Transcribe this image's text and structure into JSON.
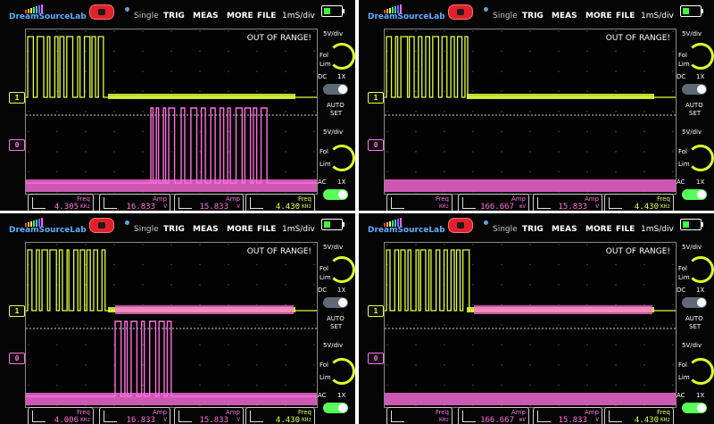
{
  "header": {
    "brand": "DreamSourceLab",
    "mode": "Single",
    "menu": [
      "TRIG",
      "MEAS",
      "MORE",
      "FILE"
    ],
    "timebase": "1mS/div"
  },
  "status": {
    "out_of_range": "OUT OF RANGE!"
  },
  "channels": {
    "ch1_marker": "1",
    "ch0_marker": "0"
  },
  "side_panel": {
    "ch1_scale": "5V/div",
    "ch0_scale": "5V/div",
    "fine": "Fol",
    "lim": "Lim",
    "dc": "DC",
    "ac": "AC",
    "x1": "1X",
    "auto": "AUTO",
    "set": "SET"
  },
  "colors": {
    "ch1": "#e2ff3a",
    "ch0": "#ff6ee0",
    "background": "#050505",
    "run_button": "#e0202a"
  },
  "screens": [
    {
      "id": "top-left",
      "measurements": [
        {
          "label": "Freq",
          "value": "4.305",
          "unit": "KHz"
        },
        {
          "label": "Amp",
          "value": "16.833",
          "unit": "V"
        },
        {
          "label": "Amp",
          "value": "15.833",
          "unit": "V"
        },
        {
          "label": "Freq",
          "value": "4.430",
          "unit": "KHz"
        }
      ]
    },
    {
      "id": "top-right",
      "measurements": [
        {
          "label": "Freq",
          "value": "",
          "unit": "KHz"
        },
        {
          "label": "Amp",
          "value": "166.667",
          "unit": "mV"
        },
        {
          "label": "Amp",
          "value": "15.833",
          "unit": "V"
        },
        {
          "label": "Freq",
          "value": "4.430",
          "unit": "KHz"
        }
      ]
    },
    {
      "id": "bottom-left",
      "measurements": [
        {
          "label": "Freq",
          "value": "4.006",
          "unit": "KHz"
        },
        {
          "label": "Amp",
          "value": "16.833",
          "unit": "V"
        },
        {
          "label": "Amp",
          "value": "15.833",
          "unit": "V"
        },
        {
          "label": "Freq",
          "value": "4.430",
          "unit": "KHz"
        }
      ]
    },
    {
      "id": "bottom-right",
      "measurements": [
        {
          "label": "Freq",
          "value": "",
          "unit": "KHz"
        },
        {
          "label": "Amp",
          "value": "166.667",
          "unit": "mV"
        },
        {
          "label": "Amp",
          "value": "15.833",
          "unit": "V"
        },
        {
          "label": "Freq",
          "value": "4.430",
          "unit": "KHz"
        }
      ]
    }
  ]
}
